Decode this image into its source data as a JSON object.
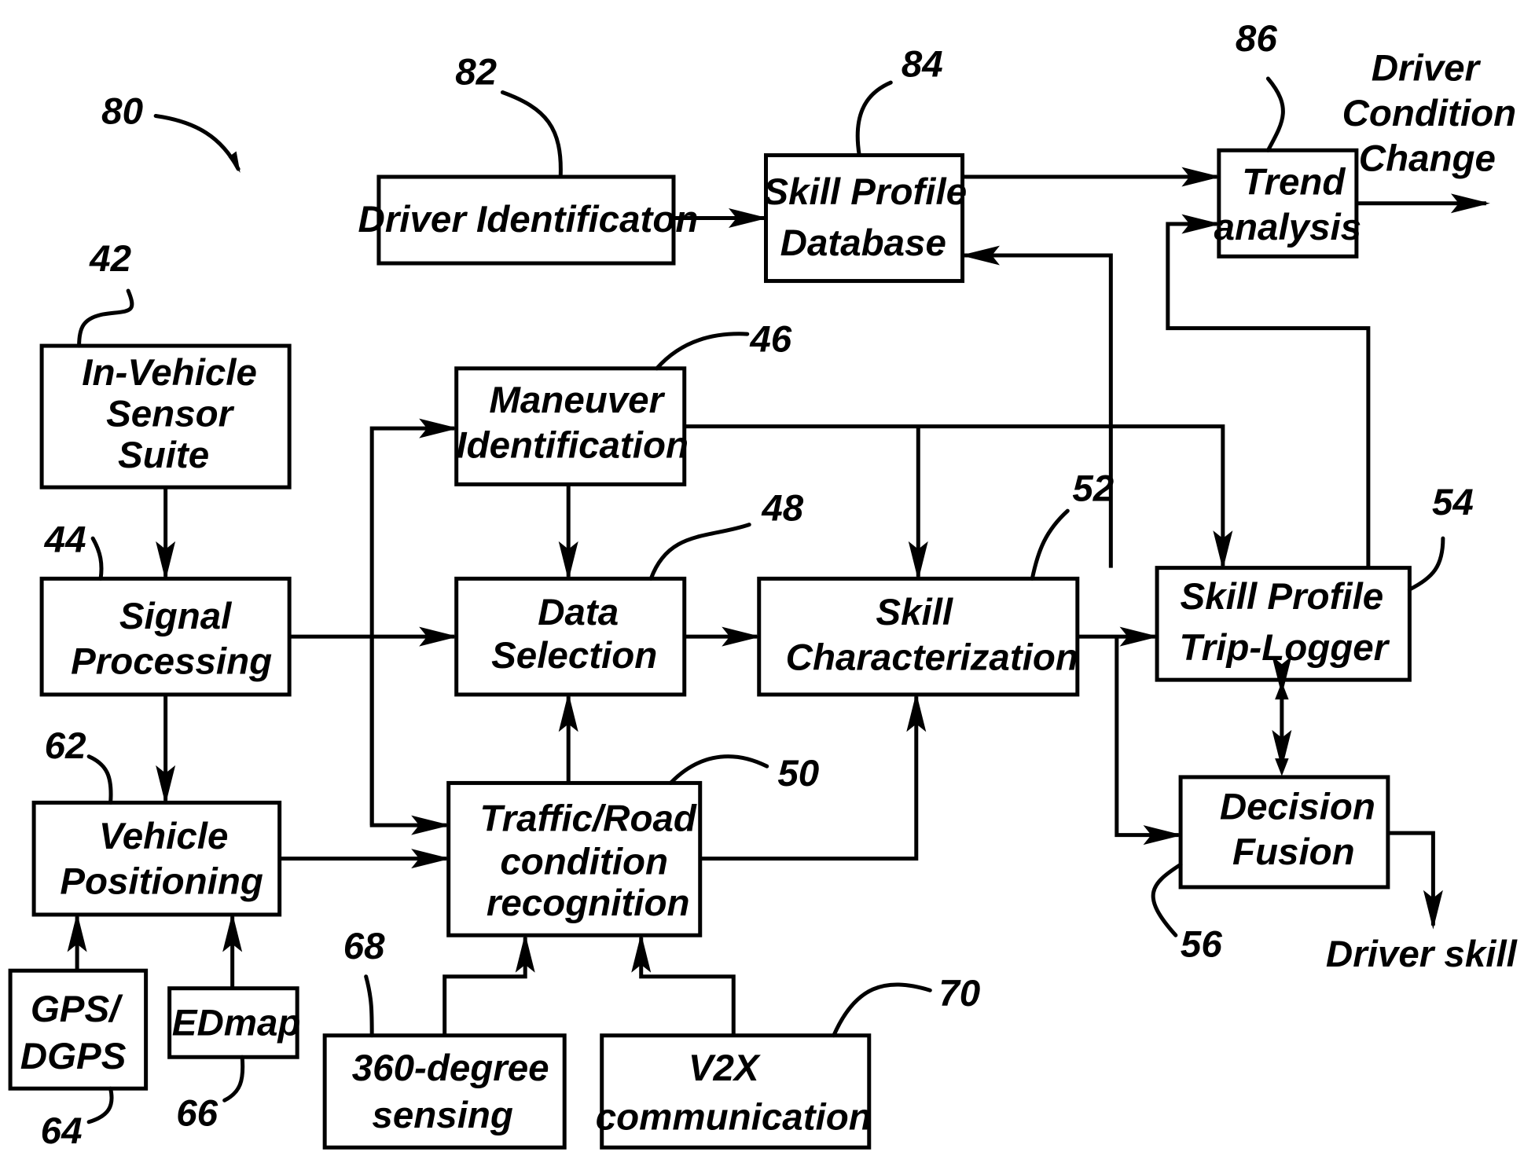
{
  "figure": {
    "ref": "80",
    "blocks": {
      "driver_identification": {
        "ref": "82",
        "lines": [
          "Driver Identificaton"
        ]
      },
      "skill_profile_database": {
        "ref": "84",
        "lines": [
          "Skill Profile",
          "Database"
        ]
      },
      "trend_analysis": {
        "ref": "86",
        "lines": [
          "Trend",
          "analysis"
        ]
      },
      "in_vehicle_sensor_suite": {
        "ref": "42",
        "lines": [
          "In-Vehicle",
          "Sensor",
          "Suite"
        ]
      },
      "signal_processing": {
        "ref": "44",
        "lines": [
          "Signal",
          "Processing"
        ]
      },
      "maneuver_identification": {
        "ref": "46",
        "lines": [
          "Maneuver",
          "Identification"
        ]
      },
      "data_selection": {
        "ref": "48",
        "lines": [
          "Data",
          "Selection"
        ]
      },
      "skill_characterization": {
        "ref": "52",
        "lines": [
          "Skill",
          "Characterization"
        ]
      },
      "skill_profile_trip_logger": {
        "ref": "54",
        "lines": [
          "Skill Profile",
          "Trip-Logger"
        ]
      },
      "traffic_road_recognition": {
        "ref": "50",
        "lines": [
          "Traffic/Road",
          "condition",
          "recognition"
        ]
      },
      "decision_fusion": {
        "ref": "56",
        "lines": [
          "Decision",
          "Fusion"
        ]
      },
      "vehicle_positioning": {
        "ref": "62",
        "lines": [
          "Vehicle",
          "Positioning"
        ]
      },
      "gps_dgps": {
        "ref": "64",
        "lines": [
          "GPS/",
          "DGPS"
        ]
      },
      "edmap": {
        "ref": "66",
        "lines": [
          "EDmap"
        ]
      },
      "sensing_360": {
        "ref": "68",
        "lines": [
          "360-degree",
          "sensing"
        ]
      },
      "v2x": {
        "ref": "70",
        "lines": [
          "V2X",
          "communication"
        ]
      }
    },
    "outputs": {
      "driver_condition_change": [
        "Driver",
        "Condition",
        "Change"
      ],
      "driver_skill": "Driver skill"
    }
  }
}
